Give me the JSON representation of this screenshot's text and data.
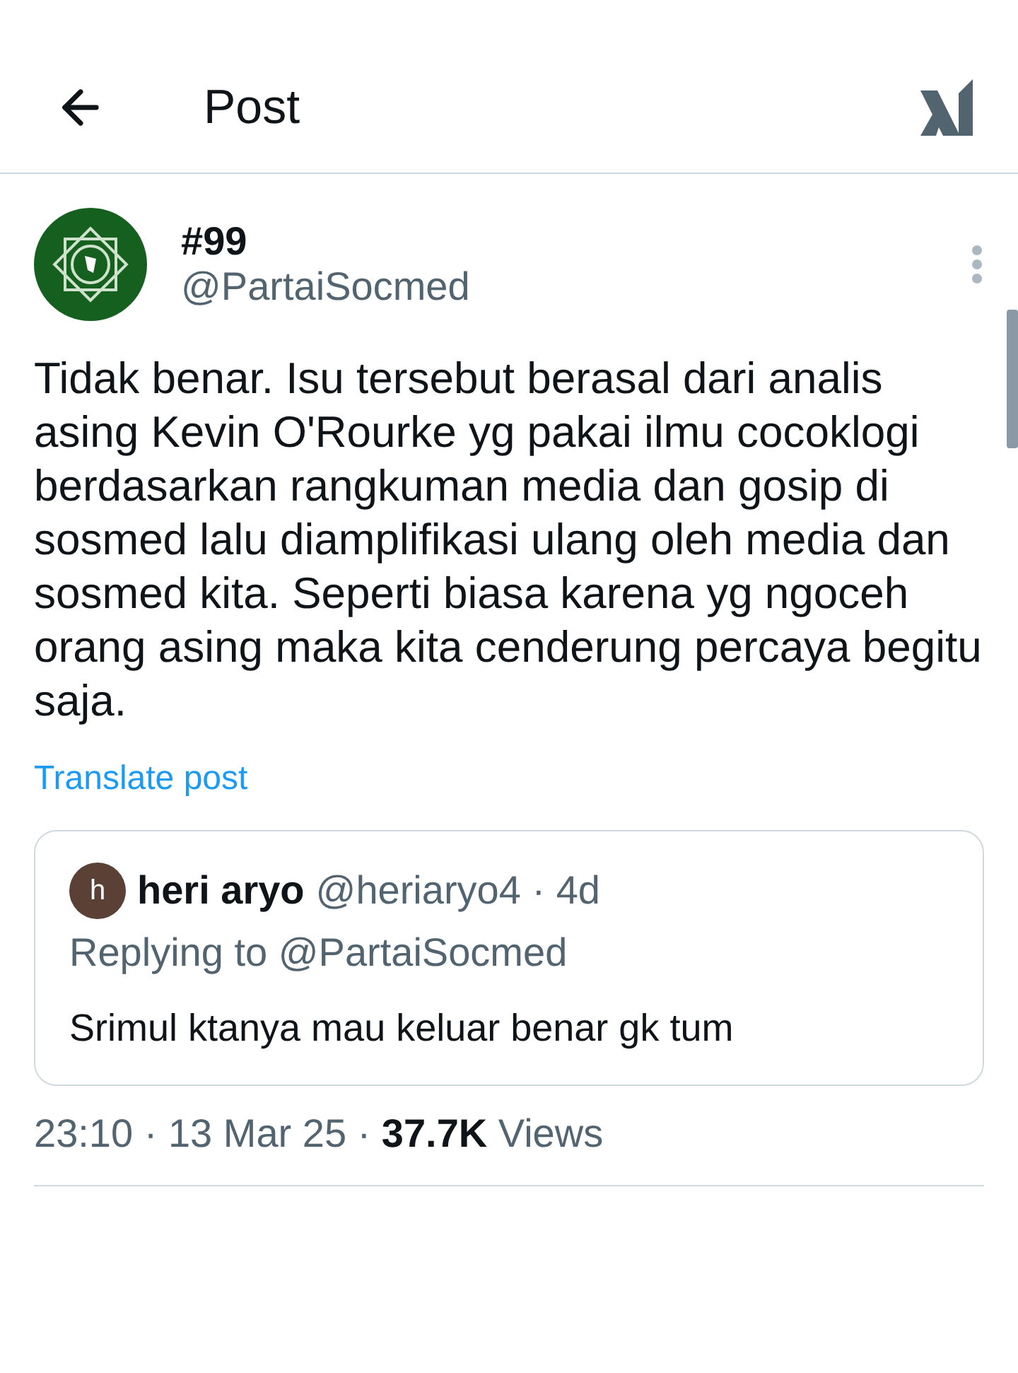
{
  "header": {
    "title": "Post"
  },
  "post": {
    "display_name": "#99",
    "handle": "@PartaiSocmed",
    "text": "Tidak benar. Isu tersebut berasal dari analis asing Kevin O'Rourke yg pakai ilmu cocoklogi berdasarkan rangkuman media dan gosip di sosmed lalu diamplifikasi ulang oleh media dan sosmed kita. Seperti biasa karena yg ngoceh orang asing maka kita cenderung percaya begitu saja.",
    "translate_link": "Translate post",
    "quoted": {
      "avatar_letter": "h",
      "name": "heri aryo",
      "handle_time": "@heriaryo4 · 4d",
      "replying_to": "Replying to @PartaiSocmed",
      "text": "Srimul ktanya mau keluar benar gk tum"
    },
    "meta": "23:10 · 13 Mar 25 · **37.7K** Views"
  }
}
